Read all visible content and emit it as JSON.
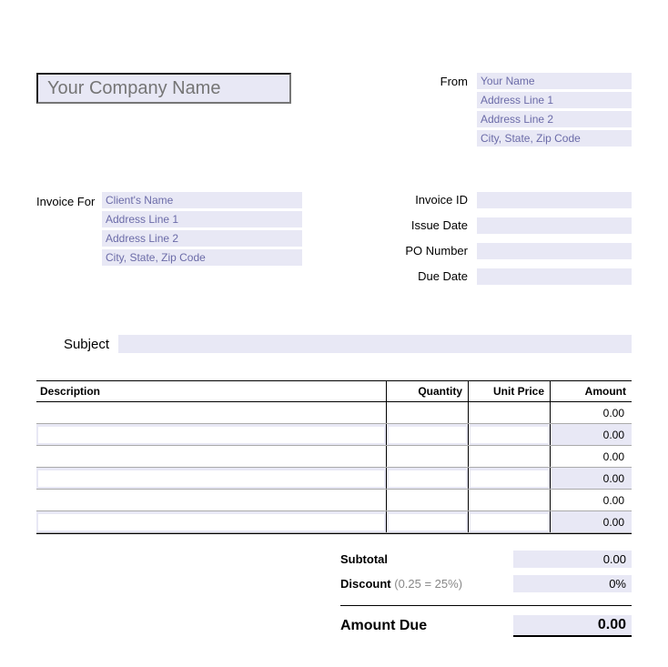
{
  "company": {
    "name_placeholder": "Your Company Name"
  },
  "from": {
    "label": "From",
    "name_placeholder": "Your Name",
    "addr1_placeholder": "Address Line 1",
    "addr2_placeholder": "Address Line 2",
    "city_placeholder": "City, State, Zip Code"
  },
  "invoice_for": {
    "label": "Invoice For",
    "client_placeholder": "Client's Name",
    "addr1_placeholder": "Address Line 1",
    "addr2_placeholder": "Address Line 2",
    "city_placeholder": "City, State, Zip Code"
  },
  "meta": {
    "invoice_id_label": "Invoice ID",
    "issue_date_label": "Issue Date",
    "po_number_label": "PO Number",
    "due_date_label": "Due Date"
  },
  "subject": {
    "label": "Subject"
  },
  "table": {
    "headers": {
      "description": "Description",
      "quantity": "Quantity",
      "unit_price": "Unit Price",
      "amount": "Amount"
    },
    "rows": [
      {
        "amount": "0.00"
      },
      {
        "amount": "0.00"
      },
      {
        "amount": "0.00"
      },
      {
        "amount": "0.00"
      },
      {
        "amount": "0.00"
      },
      {
        "amount": "0.00"
      }
    ]
  },
  "totals": {
    "subtotal_label": "Subtotal",
    "subtotal_value": "0.00",
    "discount_label": "Discount",
    "discount_hint": " (0.25 = 25%)",
    "discount_value": "0%",
    "amount_due_label": "Amount Due",
    "amount_due_value": "0.00"
  }
}
